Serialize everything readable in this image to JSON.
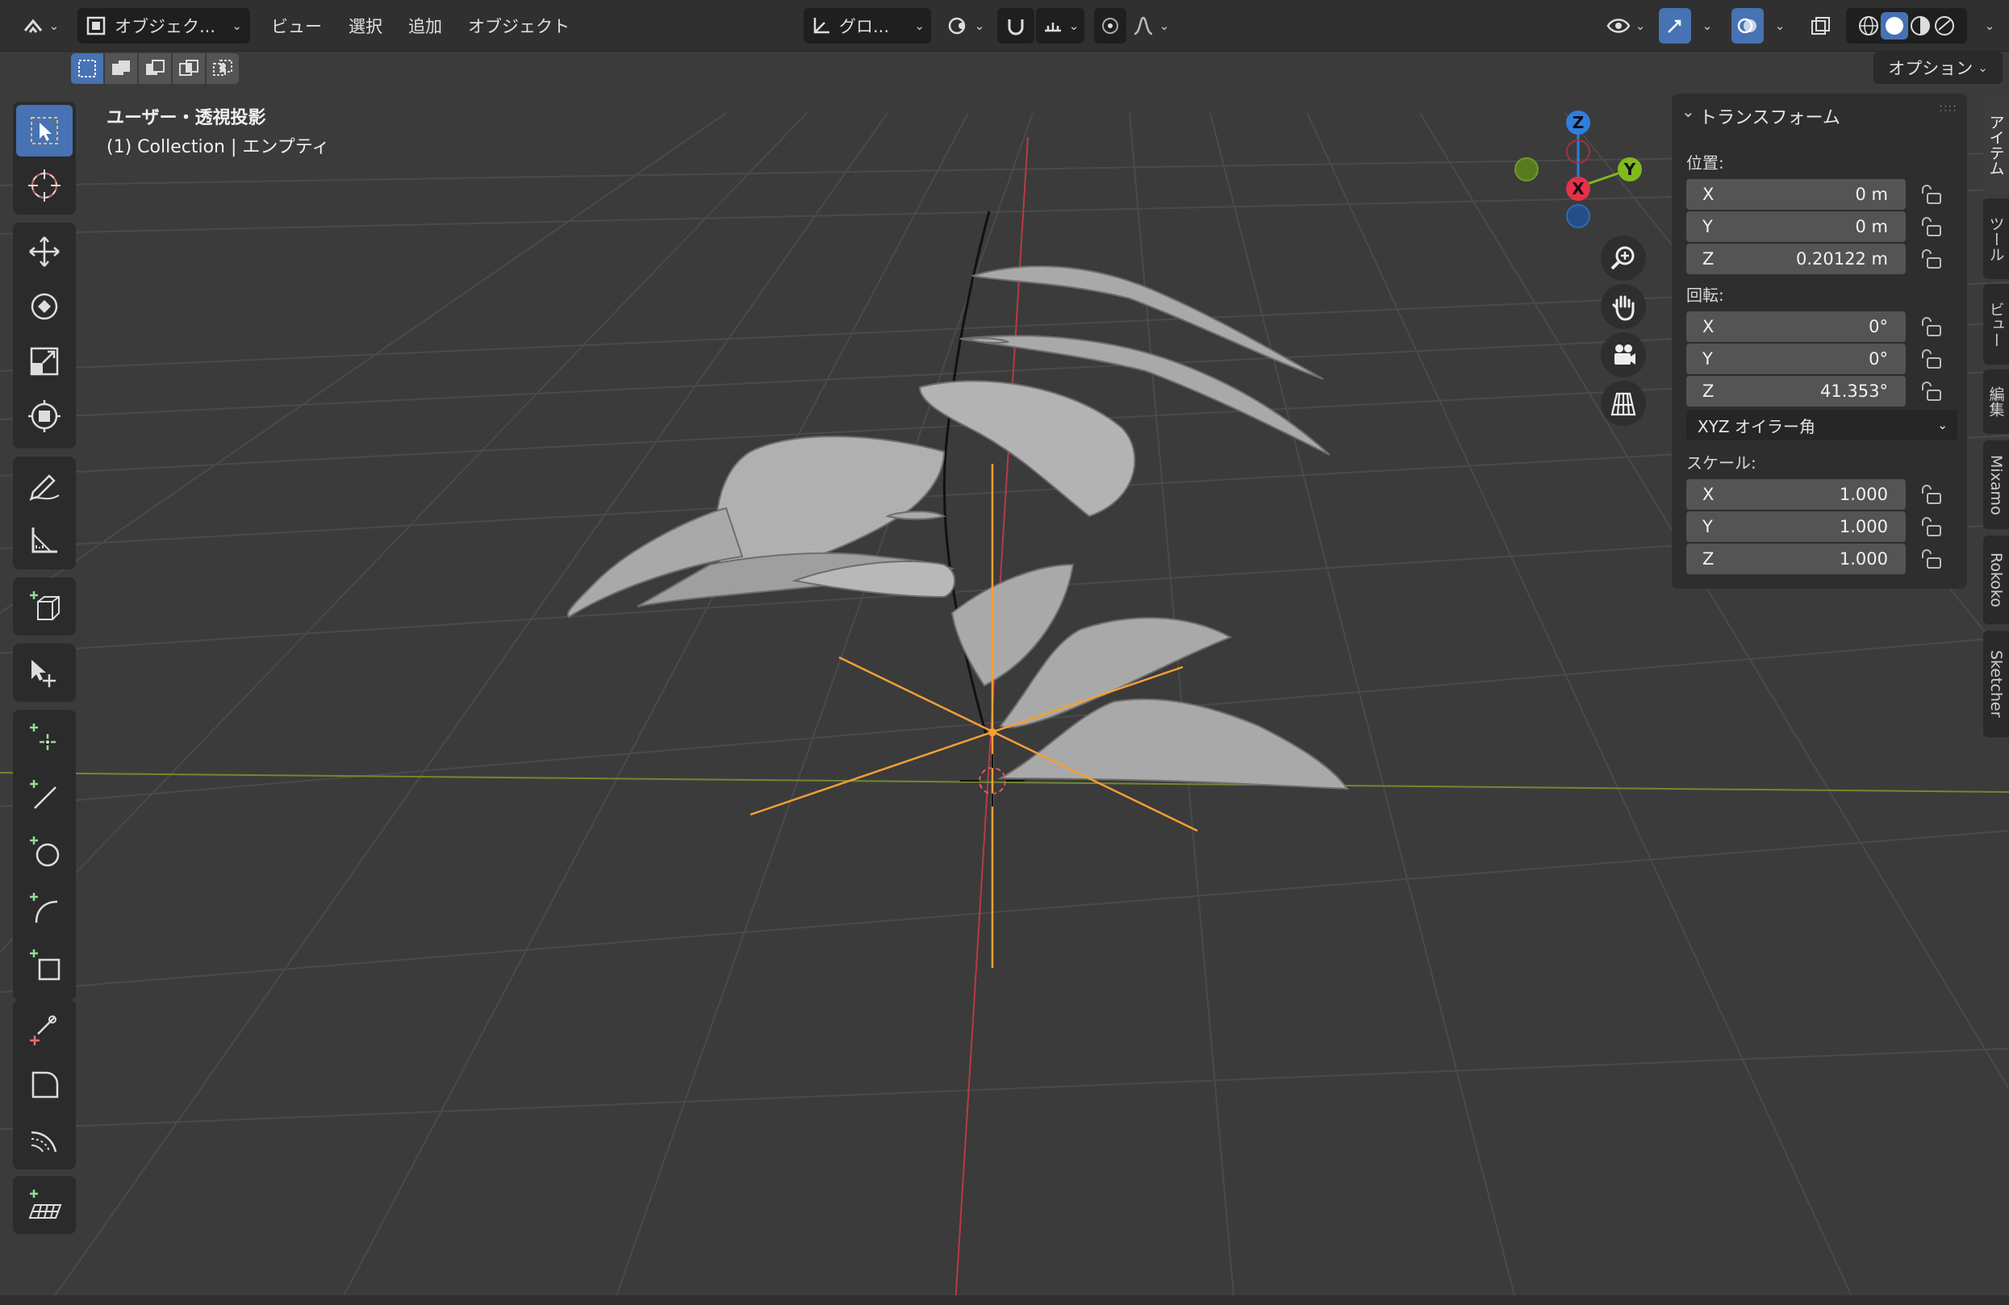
{
  "header": {
    "mode_label": "オブジェク...",
    "menu": [
      "ビュー",
      "選択",
      "追加",
      "オブジェクト"
    ],
    "transform_orientation": "グロ...",
    "options_label": "オプション"
  },
  "viewport": {
    "view_name": "ユーザー・透視投影",
    "collection_info": "(1) Collection | エンプティ"
  },
  "gizmo": {
    "z": "Z",
    "y": "Y",
    "x": "X"
  },
  "transform_panel": {
    "title": "トランスフォーム",
    "location_label": "位置:",
    "location": [
      {
        "axis": "X",
        "value": "0 m"
      },
      {
        "axis": "Y",
        "value": "0 m"
      },
      {
        "axis": "Z",
        "value": "0.20122 m"
      }
    ],
    "rotation_label": "回転:",
    "rotation": [
      {
        "axis": "X",
        "value": "0°"
      },
      {
        "axis": "Y",
        "value": "0°"
      },
      {
        "axis": "Z",
        "value": "41.353°"
      }
    ],
    "rotation_mode": "XYZ オイラー角",
    "scale_label": "スケール:",
    "scale": [
      {
        "axis": "X",
        "value": "1.000"
      },
      {
        "axis": "Y",
        "value": "1.000"
      },
      {
        "axis": "Z",
        "value": "1.000"
      }
    ]
  },
  "side_tabs": [
    "アイテム",
    "ツール",
    "ビュー",
    "編集",
    "Mixamo",
    "Rokoko",
    "Sketcher"
  ],
  "colors": {
    "accent": "#4772b3",
    "axis_x": "#e8304a",
    "axis_y": "#7fba1e",
    "axis_z": "#2e7fe0",
    "selection": "#ff9a1f"
  }
}
